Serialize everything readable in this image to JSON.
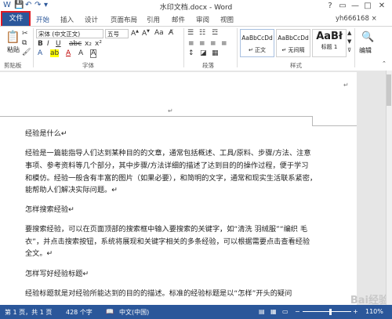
{
  "title": "水印文档.docx - Word",
  "window_controls": [
    "?",
    "▭",
    "—",
    "□",
    "✕"
  ],
  "tabs": [
    "文件",
    "开始",
    "插入",
    "设计",
    "页面布局",
    "引用",
    "邮件",
    "审阅",
    "视图"
  ],
  "user": "yh666168 ×",
  "ribbon": {
    "paste": "粘贴",
    "clipboard": "剪贴板",
    "font_name": "宋体 (中文正文)",
    "font_size": "五号",
    "font_group": "字体",
    "paragraph_group": "段落",
    "styles_group": "样式",
    "edit": "编辑",
    "styles": [
      {
        "preview": "AaBbCcDd",
        "name": "↵ 正文"
      },
      {
        "preview": "AaBbCcDd",
        "name": "↵ 无间隔"
      },
      {
        "preview": "AaBł",
        "name": "标题 1"
      }
    ]
  },
  "doc": {
    "lines": [
      "经验是什么↵",
      "经验是一篇能指导人们达到某种目的的文章，通常包括概述、工具/原料、步骤/方法、注意",
      "事项、参考资料等几个部分，其中步骤/方法详细的描述了达到目的的操作过程，便于学习",
      "和模仿。经验一般含有丰富的图片（如果必要），和简明的文字，通常和现实生活联系紧密，",
      "能帮助人们解决实际问题。↵",
      "",
      "  怎样搜索经验↵",
      "",
      "要搜索经验，可以在页面顶部的搜索框中输入要搜索的关键字，如“清洗 羽绒服”“编织 毛",
      "衣”，并点击搜索按钮，系统将展现和关键字相关的多条经验，可以根据需要点击查看经验",
      "全文。↵",
      "",
      "  怎样写好经验标题↵",
      "",
      "经验标题就是对经验所能达到的目的的描述。标准的经验标题是以“怎样”开头的疑问"
    ]
  },
  "status": {
    "page": "第 1 页，共 1 页",
    "words": "428 个字",
    "lang": "中文(中国)",
    "zoom": "110%"
  },
  "watermark": "Bai经验"
}
